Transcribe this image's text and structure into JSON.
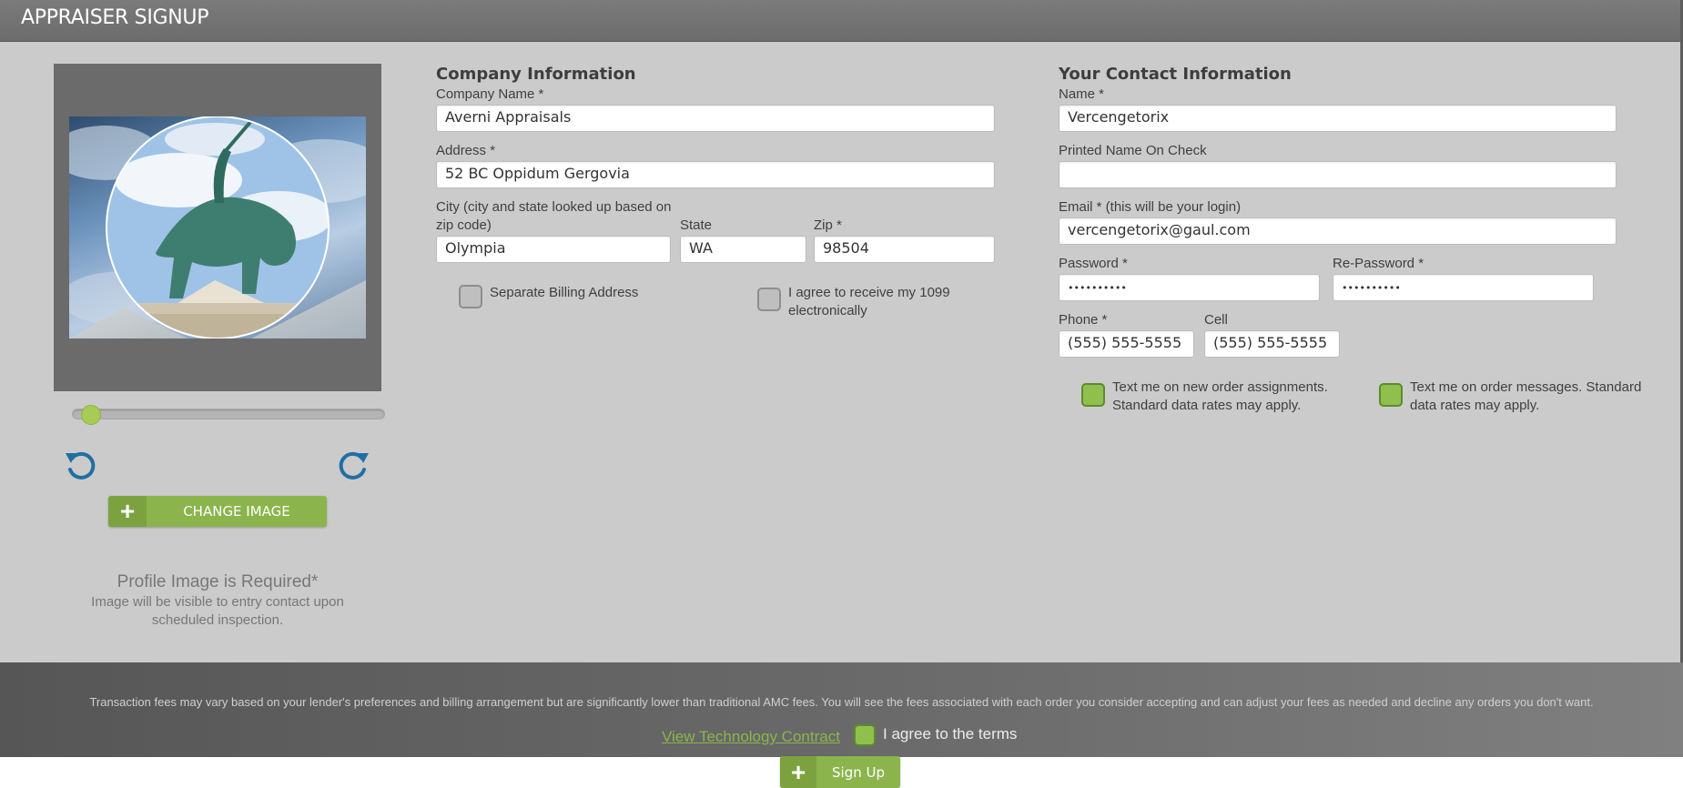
{
  "header": {
    "title": "APPRAISER SIGNUP"
  },
  "profile": {
    "change_image_label": "CHANGE IMAGE",
    "required_title": "Profile Image is Required*",
    "required_desc": "Image will be visible to entry contact upon scheduled inspection.",
    "zoom_level": 0.05,
    "icons": {
      "rotate_left": "rotate-left-icon",
      "rotate_right": "rotate-right-icon",
      "plus": "plus-icon"
    }
  },
  "company": {
    "section_title": "Company Information",
    "name_label": "Company Name *",
    "name_value": "Averni Appraisals",
    "address_label": "Address *",
    "address_value": "52 BC Oppidum Gergovia",
    "city_label": "City (city and state looked up based on zip code)",
    "city_value": "Olympia",
    "state_label": "State",
    "state_value": "WA",
    "zip_label": "Zip *",
    "zip_value": "98504",
    "separate_billing_label": "Separate Billing Address",
    "separate_billing_checked": false,
    "agree_1099_label": "I agree to receive my 1099 electronically",
    "agree_1099_checked": false
  },
  "contact": {
    "section_title": "Your Contact Information",
    "name_label": "Name *",
    "name_value": "Vercengetorix",
    "printed_name_label": "Printed Name On Check",
    "printed_name_value": "",
    "email_label": "Email * (this will be your login)",
    "email_value": "vercengetorix@gaul.com",
    "password_label": "Password *",
    "password_value": "••••••••••",
    "repassword_label": "Re-Password *",
    "repassword_value": "••••••••••",
    "phone_label": "Phone *",
    "phone_value": "(555) 555-5555",
    "cell_label": "Cell",
    "cell_value": "(555) 555-5555",
    "text_orders_label": "Text me on new order assignments. Standard data rates may apply.",
    "text_orders_checked": true,
    "text_messages_label": "Text me on order messages. Standard data rates may apply.",
    "text_messages_checked": true
  },
  "footer": {
    "notice": "Transaction fees may vary based on your lender's preferences and billing arrangement but are significantly lower than traditional AMC fees. You will see the fees associated with each order you consider accepting and can adjust your fees as needed and decline any orders you don't want.",
    "contract_link": "View Technology Contract",
    "agree_label": "I agree to the terms",
    "agree_checked": true,
    "signup_label": "Sign Up"
  },
  "colors": {
    "accent": "#8bb54c",
    "link": "#8bb54c",
    "header": "#6c6c6c",
    "panel": "#cbcbcb"
  }
}
